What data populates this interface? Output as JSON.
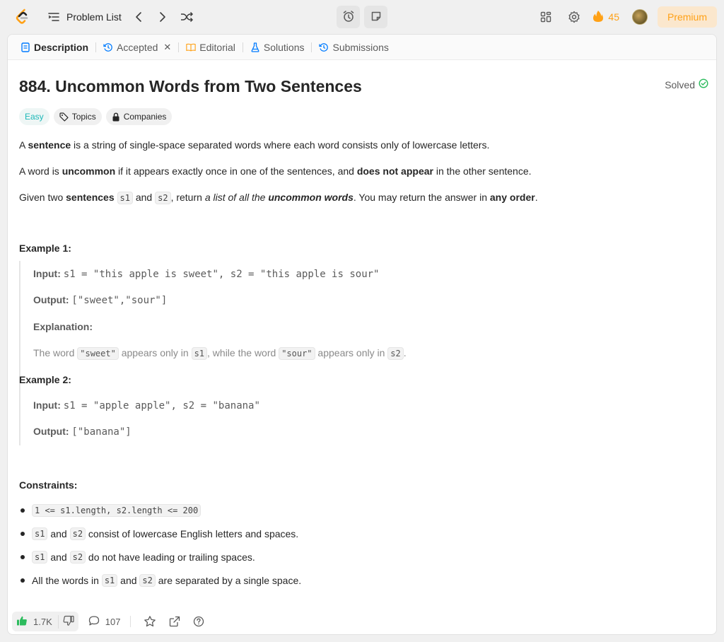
{
  "nav": {
    "problem_list_label": "Problem List",
    "streak_count": "45",
    "premium_label": "Premium"
  },
  "tabs": [
    {
      "label": "Description"
    },
    {
      "label": "Accepted"
    },
    {
      "label": "Editorial"
    },
    {
      "label": "Solutions"
    },
    {
      "label": "Submissions"
    }
  ],
  "problem": {
    "title": "884. Uncommon Words from Two Sentences",
    "status": "Solved",
    "difficulty": "Easy",
    "topics_label": "Topics",
    "companies_label": "Companies"
  },
  "description": {
    "p1": {
      "a": "A ",
      "b": "sentence",
      "c": " is a string of single-space separated words where each word consists only of lowercase letters."
    },
    "p2": {
      "a": "A word is ",
      "b": "uncommon",
      "c": " if it appears exactly once in one of the sentences, and ",
      "d": "does not appear",
      "e": " in the other sentence."
    },
    "p3": {
      "a": "Given two ",
      "b": "sentences",
      "c": " ",
      "code1": "s1",
      "d": " and ",
      "code2": "s2",
      "e": ", return ",
      "f": "a list of all the ",
      "g": "uncommon words",
      "h": ". You may return the answer in ",
      "i": "any order",
      "j": "."
    }
  },
  "example1": {
    "heading": "Example 1:",
    "input_label": "Input:",
    "input_value": "s1 = \"this apple is sweet\", s2 = \"this apple is sour\"",
    "output_label": "Output:",
    "output_value": "[\"sweet\",\"sour\"]",
    "explanation_label": "Explanation:",
    "explanation": {
      "a": "The word ",
      "code1": "\"sweet\"",
      "b": " appears only in ",
      "code2": "s1",
      "c": ", while the word ",
      "code3": "\"sour\"",
      "d": " appears only in ",
      "code4": "s2",
      "e": "."
    }
  },
  "example2": {
    "heading": "Example 2:",
    "input_label": "Input:",
    "input_value": "s1 = \"apple apple\", s2 = \"banana\"",
    "output_label": "Output:",
    "output_value": "[\"banana\"]"
  },
  "constraints": {
    "heading": "Constraints:",
    "c1_code": "1 <= s1.length, s2.length <= 200",
    "c2": {
      "code1": "s1",
      "a": " and ",
      "code2": "s2",
      "b": " consist of lowercase English letters and spaces."
    },
    "c3": {
      "code1": "s1",
      "a": " and ",
      "code2": "s2",
      "b": " do not have leading or trailing spaces."
    },
    "c4": {
      "a": "All the words in ",
      "code1": "s1",
      "b": " and ",
      "code2": "s2",
      "c": " are separated by a single space."
    }
  },
  "footer": {
    "likes": "1.7K",
    "comments": "107"
  },
  "colors": {
    "brand": "#ffa116",
    "easy": "#1cb8b8",
    "solved_check": "#2cbb5d",
    "like_icon": "#2cbb5d"
  }
}
